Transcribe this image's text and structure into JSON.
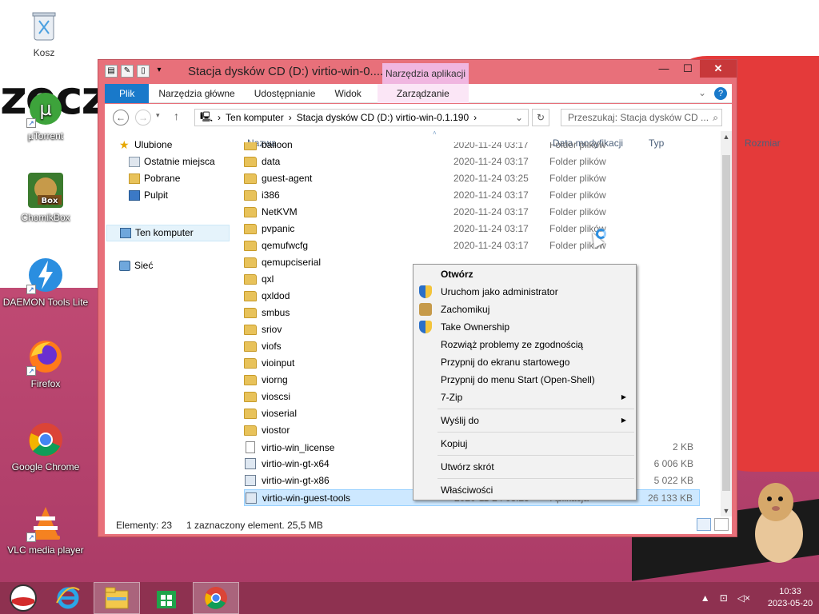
{
  "desktop": {
    "wallpaper_text_left": "zecz",
    "icons": [
      {
        "label": "Kosz",
        "icon": "recycle-bin-icon"
      },
      {
        "label": "µTorrent",
        "icon": "utorrent-icon"
      },
      {
        "label": "ChomikBox",
        "icon": "chomikbox-icon"
      },
      {
        "label": "DAEMON Tools Lite",
        "icon": "daemon-tools-icon"
      },
      {
        "label": "Firefox",
        "icon": "firefox-icon"
      },
      {
        "label": "Google Chrome",
        "icon": "chrome-icon"
      },
      {
        "label": "VLC media player",
        "icon": "vlc-icon"
      }
    ]
  },
  "window": {
    "title": "Stacja dysków CD (D:) virtio-win-0....",
    "contextual_tab_group": "Narzędzia aplikacji",
    "ribbon_tabs": [
      "Plik",
      "Narzędzia główne",
      "Udostępnianie",
      "Widok",
      "Zarządzanie"
    ],
    "help": "?",
    "address_path": [
      "Ten komputer",
      "Stacja dysków CD (D:) virtio-win-0.1.190"
    ],
    "search_placeholder": "Przeszukaj: Stacja dysków CD ...",
    "nav": {
      "favorites": "Ulubione",
      "recent": "Ostatnie miejsca",
      "downloads": "Pobrane",
      "desktop": "Pulpit",
      "this_pc": "Ten komputer",
      "network": "Sieć"
    },
    "columns": {
      "name": "Nazwa",
      "date": "Data modyfikacji",
      "type": "Typ",
      "size": "Rozmiar"
    },
    "files": [
      {
        "name": "balloon",
        "date": "2020-11-24 03:17",
        "type": "Folder plików",
        "size": "",
        "kind": "folder"
      },
      {
        "name": "data",
        "date": "2020-11-24 03:17",
        "type": "Folder plików",
        "size": "",
        "kind": "folder"
      },
      {
        "name": "guest-agent",
        "date": "2020-11-24 03:25",
        "type": "Folder plików",
        "size": "",
        "kind": "folder"
      },
      {
        "name": "i386",
        "date": "2020-11-24 03:17",
        "type": "Folder plików",
        "size": "",
        "kind": "folder"
      },
      {
        "name": "NetKVM",
        "date": "2020-11-24 03:17",
        "type": "Folder plików",
        "size": "",
        "kind": "folder"
      },
      {
        "name": "pvpanic",
        "date": "2020-11-24 03:17",
        "type": "Folder plików",
        "size": "",
        "kind": "folder"
      },
      {
        "name": "qemufwcfg",
        "date": "2020-11-24 03:17",
        "type": "Folder plików",
        "size": "",
        "kind": "folder"
      },
      {
        "name": "qemupciserial",
        "date": "",
        "type": "",
        "size": "",
        "kind": "folder"
      },
      {
        "name": "qxl",
        "date": "",
        "type": "",
        "size": "",
        "kind": "folder"
      },
      {
        "name": "qxldod",
        "date": "",
        "type": "",
        "size": "",
        "kind": "folder"
      },
      {
        "name": "smbus",
        "date": "",
        "type": "",
        "size": "",
        "kind": "folder"
      },
      {
        "name": "sriov",
        "date": "",
        "type": "",
        "size": "",
        "kind": "folder"
      },
      {
        "name": "viofs",
        "date": "",
        "type": "",
        "size": "",
        "kind": "folder"
      },
      {
        "name": "vioinput",
        "date": "",
        "type": "",
        "size": "",
        "kind": "folder"
      },
      {
        "name": "viorng",
        "date": "",
        "type": "",
        "size": "",
        "kind": "folder"
      },
      {
        "name": "vioscsi",
        "date": "",
        "type": "",
        "size": "",
        "kind": "folder"
      },
      {
        "name": "vioserial",
        "date": "",
        "type": "",
        "size": "",
        "kind": "folder"
      },
      {
        "name": "viostor",
        "date": "",
        "type": "",
        "size": "",
        "kind": "folder"
      },
      {
        "name": "virtio-win_license",
        "date": "",
        "type": "",
        "size": "2 KB",
        "kind": "file"
      },
      {
        "name": "virtio-win-gt-x64",
        "date": "",
        "type": "",
        "size": "6 006 KB",
        "kind": "msi"
      },
      {
        "name": "virtio-win-gt-x86",
        "date": "",
        "type": "",
        "size": "5 022 KB",
        "kind": "msi"
      },
      {
        "name": "virtio-win-guest-tools",
        "date": "2020-11-24 03:25",
        "type": "Aplikacja",
        "size": "26 133 KB",
        "kind": "exe",
        "selected": true
      }
    ],
    "status": {
      "count": "Elementy: 23",
      "selection": "1 zaznaczony element. 25,5 MB"
    }
  },
  "context_menu": {
    "items": [
      {
        "label": "Otwórz",
        "bold": true,
        "icon": ""
      },
      {
        "label": "Uruchom jako administrator",
        "icon": "uac-shield-icon"
      },
      {
        "label": "Zachomikuj",
        "icon": "chomikbox-icon"
      },
      {
        "label": "Take Ownership",
        "icon": "uac-shield-icon"
      },
      {
        "label": "Rozwiąż problemy ze zgodnością",
        "icon": ""
      },
      {
        "label": "Przypnij do ekranu startowego",
        "icon": ""
      },
      {
        "label": "Przypnij do menu Start (Open-Shell)",
        "icon": ""
      },
      {
        "label": "7-Zip",
        "submenu": true
      },
      {
        "label": "Wyślij do",
        "submenu": true
      },
      {
        "label": "Kopiuj"
      },
      {
        "label": "Utwórz skrót"
      },
      {
        "label": "Właściwości"
      }
    ]
  },
  "taskbar": {
    "start": "start-button",
    "apps": [
      "internet-explorer-icon",
      "file-explorer-icon",
      "store-icon",
      "chrome-icon"
    ],
    "clock_time": "10:33",
    "clock_date": "2023-05-20"
  },
  "colors": {
    "window_frame": "#e8707a",
    "ribbon_file_tab": "#1979ca",
    "contextual_tab": "#f0b6e0",
    "taskbar": "#8e3150",
    "selection": "#cde8ff"
  }
}
